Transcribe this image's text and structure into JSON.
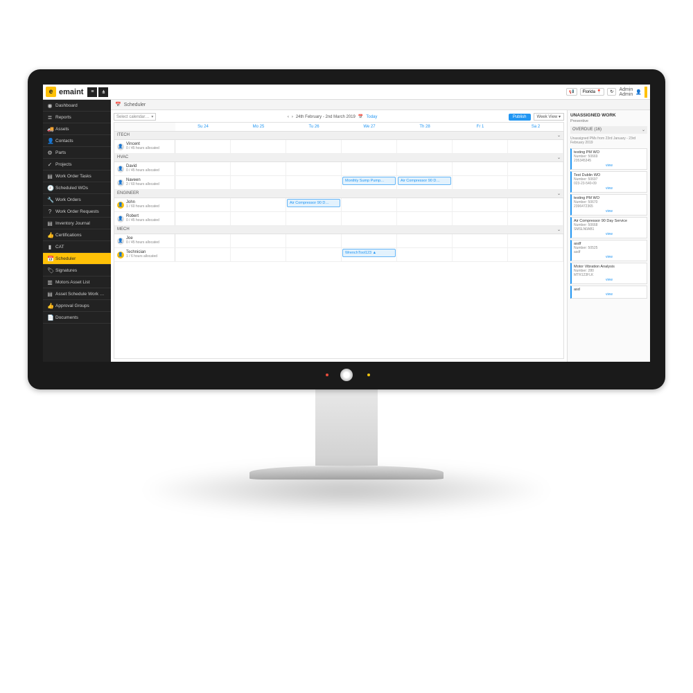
{
  "header": {
    "brand": "emaint",
    "location": "Florida",
    "user_line1": "Admin",
    "user_line2": "Admin"
  },
  "sidebar": {
    "items": [
      {
        "icon": "◉",
        "label": "Dashboard"
      },
      {
        "icon": "≣",
        "label": "Reports"
      },
      {
        "icon": "🚚",
        "label": "Assets"
      },
      {
        "icon": "👤",
        "label": "Contacts"
      },
      {
        "icon": "⚙",
        "label": "Parts"
      },
      {
        "icon": "✓",
        "label": "Projects"
      },
      {
        "icon": "▤",
        "label": "Work Order Tasks"
      },
      {
        "icon": "🕘",
        "label": "Scheduled WOs"
      },
      {
        "icon": "🔧",
        "label": "Work Orders"
      },
      {
        "icon": "?",
        "label": "Work Order Requests"
      },
      {
        "icon": "▤",
        "label": "Inventory Journal"
      },
      {
        "icon": "👍",
        "label": "Certifications"
      },
      {
        "icon": "▮",
        "label": "CAT"
      },
      {
        "icon": "📅",
        "label": "Scheduler",
        "active": true
      },
      {
        "icon": "🏷",
        "label": "Signatures"
      },
      {
        "icon": "▥",
        "label": "Motors Asset List"
      },
      {
        "icon": "▤",
        "label": "Asset Schedule Work Orders"
      },
      {
        "icon": "👍",
        "label": "Approval Groups"
      },
      {
        "icon": "📄",
        "label": "Documents"
      }
    ]
  },
  "breadcrumb": {
    "title": "Scheduler"
  },
  "scheduler": {
    "calendar_placeholder": "Select calendar…",
    "date_range": "24th February - 2nd March 2019",
    "today_label": "Today",
    "publish_label": "Publish",
    "view_label": "Week View",
    "days": [
      "Su 24",
      "Mo 25",
      "Tu 26",
      "We 27",
      "Th 28",
      "Fr 1",
      "Sa 2"
    ],
    "groups": [
      {
        "name": "ITECH",
        "resources": [
          {
            "name": "Vincent",
            "alloc": "0 / 45 hours allocated"
          }
        ]
      },
      {
        "name": "HVAC",
        "resources": [
          {
            "name": "David",
            "alloc": "0 / 45 hours allocated"
          },
          {
            "name": "Naveen",
            "alloc": "2 / 60 hours allocated",
            "events": [
              {
                "day": 3,
                "text": "Monthly Sump Pump…"
              },
              {
                "day": 4,
                "text": "Air Compressor 90 D…"
              }
            ]
          }
        ]
      },
      {
        "name": "ENGINEER",
        "resources": [
          {
            "name": "John",
            "alloc": "1 / 60 hours allocated",
            "avatar": "y",
            "events": [
              {
                "day": 2,
                "text": "Air Compressor 90 D…"
              }
            ]
          },
          {
            "name": "Robert",
            "alloc": "0 / 45 hours allocated"
          }
        ]
      },
      {
        "name": "MECH",
        "resources": [
          {
            "name": "Joe",
            "alloc": "0 / 45 hours allocated"
          },
          {
            "name": "Technician",
            "alloc": "1 / 6 hours allocated",
            "avatar": "y",
            "events": [
              {
                "day": 3,
                "text": "WrenchTool123        ▲"
              }
            ]
          }
        ]
      }
    ]
  },
  "panel": {
    "title": "UNASSIGNED WORK",
    "subtitle": "Preventive",
    "overdue_label": "OVERDUE (16)",
    "desc": "Unassigned PMs from 23rd January - 23rd February 2019",
    "cards": [
      {
        "title": "testing PM WO",
        "number": "Number: 50669",
        "code": "235345345"
      },
      {
        "title": "Test Dublin WO",
        "number": "Number: 50697",
        "code": "023-23-540-09"
      },
      {
        "title": "testing PM WO",
        "number": "Number: 50670",
        "code": "2396472365"
      },
      {
        "title": "Air Compressor 90 Day Service",
        "number": "Number: 50668",
        "code": "SMSLN0AB1"
      },
      {
        "title": "asdf",
        "number": "Number: 50525",
        "code": "asdf"
      },
      {
        "title": "Motor Vibration Analysis",
        "number": "Number: 280",
        "code": "MTR123FLK"
      },
      {
        "title": "asd",
        "number": "",
        "code": ""
      }
    ],
    "view_label": "view"
  }
}
